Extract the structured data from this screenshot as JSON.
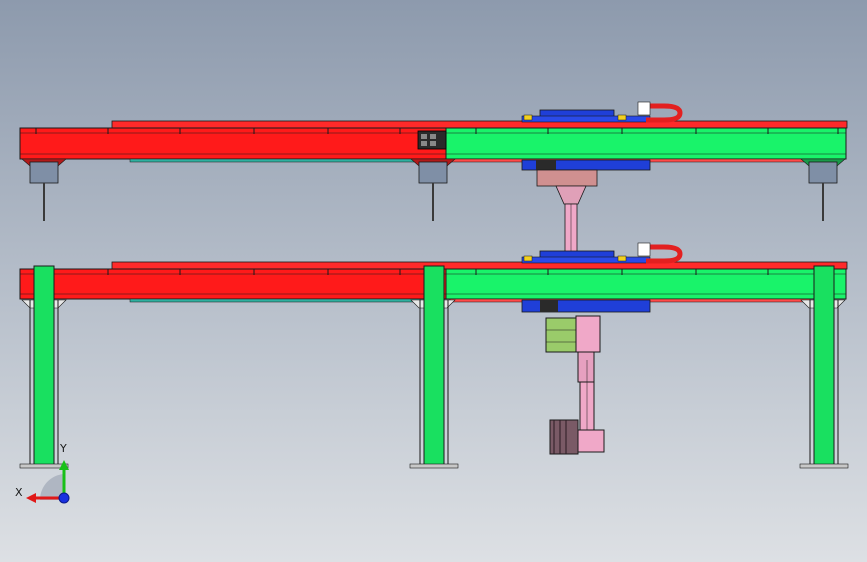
{
  "viewport": {
    "background_top": "#8d9aad",
    "background_bottom": "#dde0e4"
  },
  "colors": {
    "beam_red": "#ff1a1a",
    "beam_green": "#19f36a",
    "carriage_blue": "#1f3fd8",
    "cable_red": "#e32020",
    "arm_pink": "#f0a8c8",
    "motor_green": "#9acb6a",
    "wrist_gray": "#7a5a66",
    "post_gray": "#7f8fa6",
    "outline": "#1a1a1a"
  },
  "triad": {
    "x_label": "X",
    "y_label": "Y",
    "x_color": "#e01818",
    "y_color": "#18c018",
    "z_color": "#1830e0"
  }
}
